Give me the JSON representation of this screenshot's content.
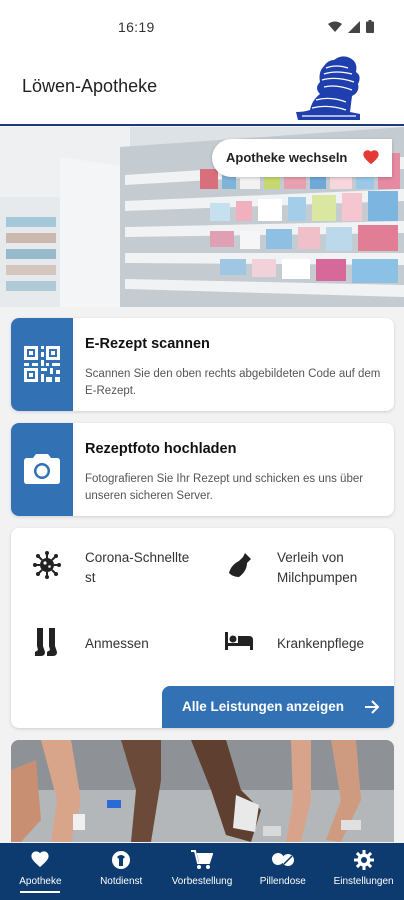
{
  "status_bar": {
    "time": "16:19"
  },
  "header": {
    "title": "Löwen-Apotheke"
  },
  "hero": {
    "switch_label": "Apotheke wechseln"
  },
  "cards": [
    {
      "title": "E-Rezept scannen",
      "description": "Scannen Sie den oben rechts abgebildeten Code auf dem E-Rezept.",
      "icon": "qr-code-icon"
    },
    {
      "title": "Rezeptfoto hochladen",
      "description": "Fotografieren Sie Ihr Rezept und schicken es uns über unseren sicheren Server.",
      "icon": "camera-icon"
    }
  ],
  "services": {
    "items": [
      {
        "label": "Corona-Schnelltest",
        "line1": "Corona-Schnellte",
        "line2": "st",
        "icon": "virus-icon"
      },
      {
        "label": "Verleih von Milchpumpen",
        "line1": "Verleih von",
        "line2": "Milchpumpen",
        "icon": "milk-pump-icon"
      },
      {
        "label": "Anmessen",
        "line1": "Anmessen",
        "line2": "",
        "icon": "stockings-icon"
      },
      {
        "label": "Krankenpflege",
        "line1": "Krankenpflege",
        "line2": "",
        "icon": "bed-icon"
      }
    ],
    "all_button": "Alle Leistungen anzeigen"
  },
  "bottom_nav": {
    "items": [
      {
        "label": "Apotheke",
        "icon": "heart-icon",
        "active": true
      },
      {
        "label": "Notdienst",
        "icon": "emergency-icon",
        "active": false
      },
      {
        "label": "Vorbestellung",
        "icon": "cart-icon",
        "active": false
      },
      {
        "label": "Pillendose",
        "icon": "pills-icon",
        "active": false
      },
      {
        "label": "Einstellungen",
        "icon": "gear-icon",
        "active": false
      }
    ]
  },
  "colors": {
    "primary": "#3271b3",
    "nav": "#0e3b6f",
    "heart": "#e53935"
  }
}
